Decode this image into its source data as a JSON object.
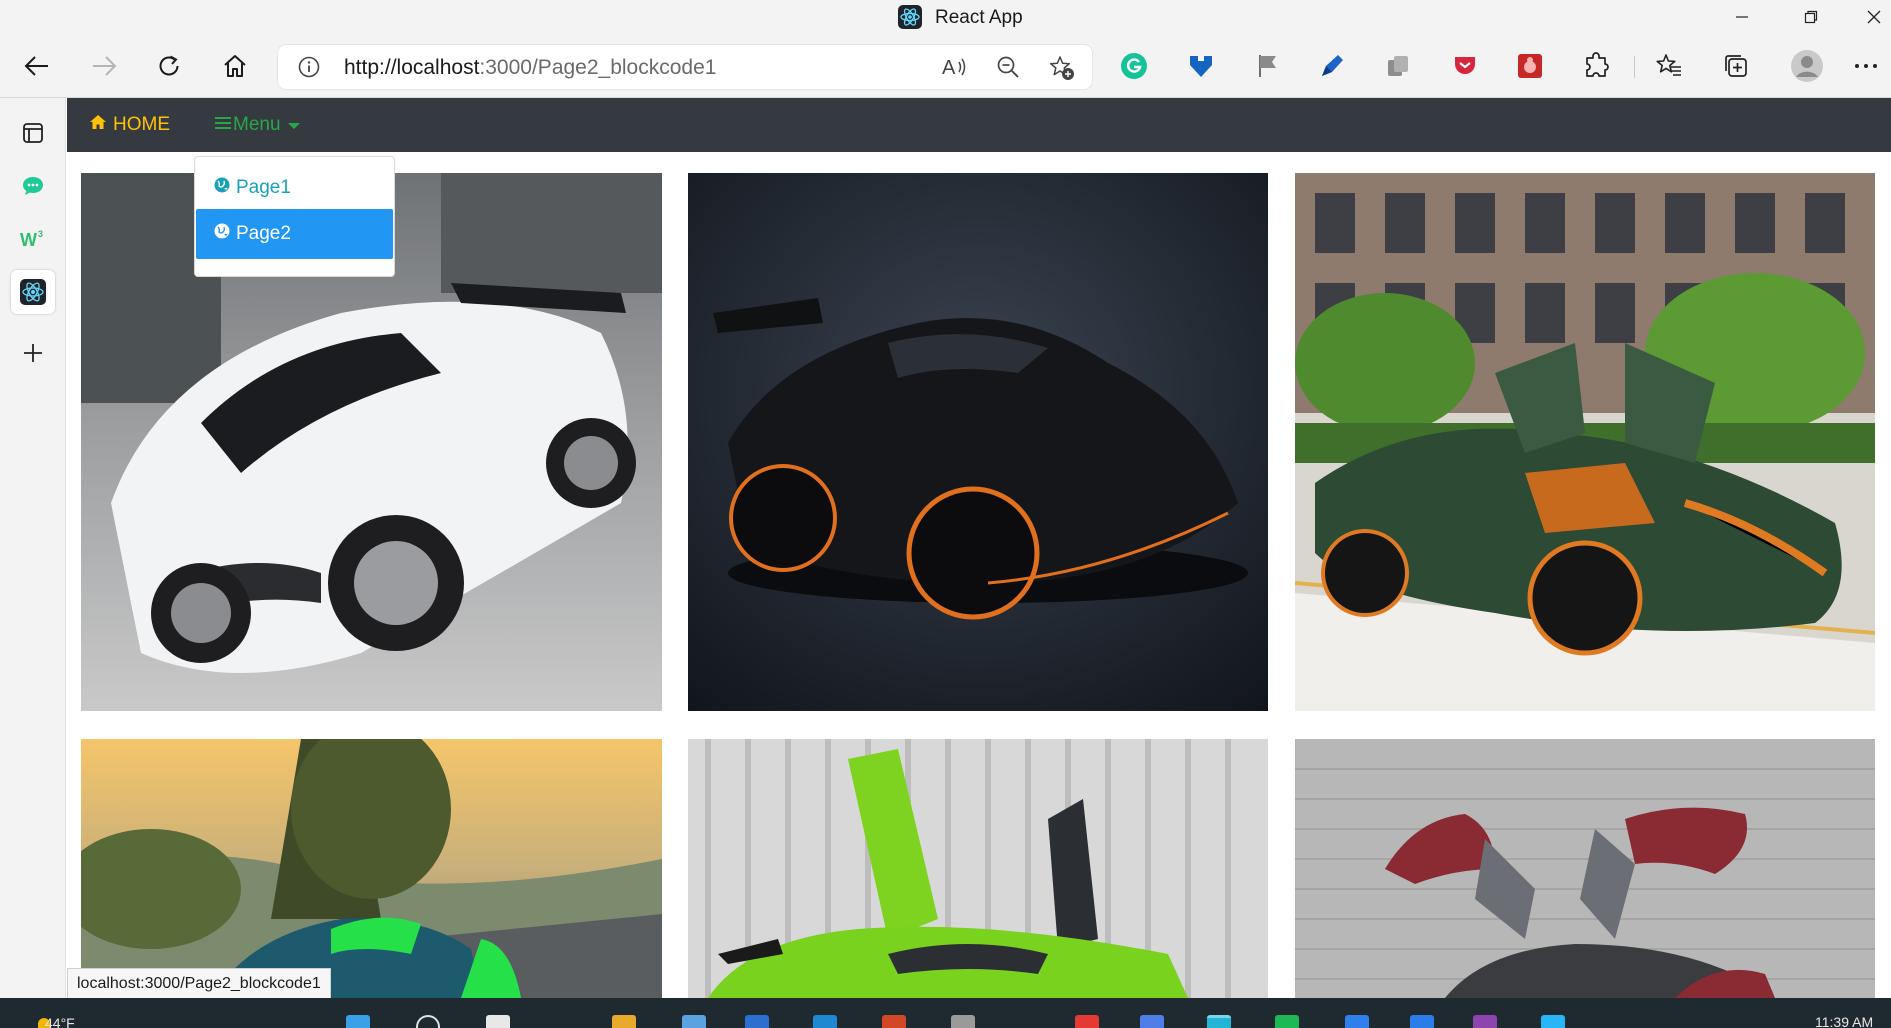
{
  "window": {
    "title": "React App",
    "minimize_icon": "minimize-icon",
    "maximize_icon": "restore-icon",
    "close_icon": "close-icon"
  },
  "browser": {
    "url_host": "http://localhost",
    "url_rest": ":3000/Page2_blockcode1",
    "buttons": [
      "back-icon",
      "forward-icon",
      "refresh-icon",
      "home-icon"
    ],
    "address_icons": [
      "site-info-icon",
      "read-aloud-icon",
      "zoom-out-icon",
      "add-favorite-icon"
    ],
    "extensions": [
      "grammarly-icon",
      "extension-shield-icon",
      "flag-icon",
      "pen-icon",
      "copy-icon",
      "pocket-icon",
      "bug-icon",
      "extensions-icon",
      "favorites-icon",
      "collections-icon",
      "profile-avatar",
      "more-icon"
    ]
  },
  "sidebar": {
    "items": [
      "tab-actions-icon",
      "chat-icon",
      "w3-icon",
      "react-app-icon",
      "add-icon"
    ]
  },
  "navbar": {
    "home_label": "HOME",
    "menu_label": "Menu",
    "home_color": "#ffc107",
    "menu_color": "#28a745",
    "bg_color": "#343a40"
  },
  "dropdown": {
    "items": [
      {
        "label": "Page1",
        "active": false
      },
      {
        "label": "Page2",
        "active": true
      }
    ],
    "active_color": "#2196f3",
    "item_color": "#17a2b8"
  },
  "gallery": {
    "images": [
      "white-hypercar-photo",
      "black-mclaren-photo",
      "green-pagani-photo",
      "green-hypercar-road-photo",
      "lime-lamborghini-photo",
      "red-gullwing-car-photo"
    ]
  },
  "status": {
    "link_preview": "localhost:3000/Page2_blockcode1"
  },
  "taskbar": {
    "weather": "44°F",
    "time": "11:39 AM"
  }
}
